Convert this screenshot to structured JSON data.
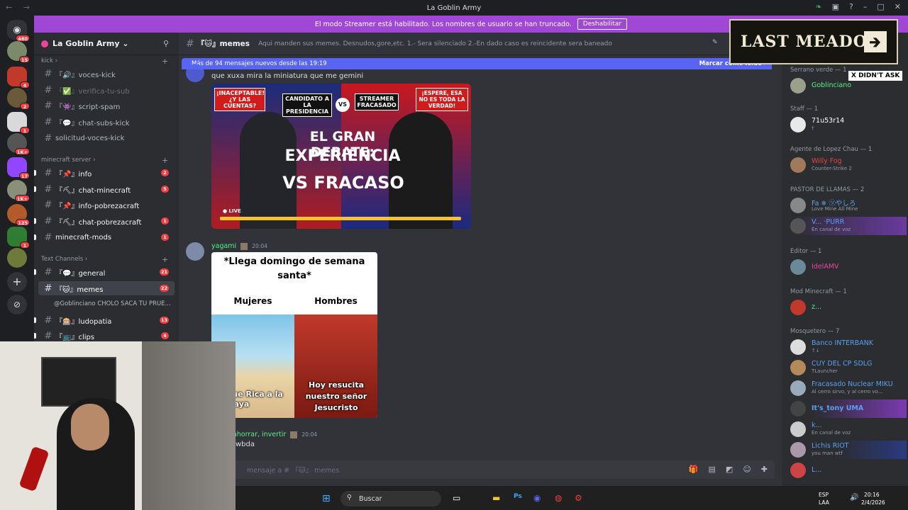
{
  "window": {
    "title": "La Goblin Army",
    "nav_arrows": "← →"
  },
  "banner": {
    "text": "El modo Streamer está habilitado. Los nombres de usuario se han truncado.",
    "button": "Deshabilitar"
  },
  "rail": {
    "badges": [
      "460",
      "15",
      "4",
      "2",
      "1",
      "1K+",
      "17",
      "1K+",
      "125",
      "1"
    ]
  },
  "server": {
    "name": "La Goblin Army ⌄"
  },
  "categories": {
    "kick": "kick ›",
    "minecraft": "minecraft server ›",
    "text": "Text Channels ›"
  },
  "channels": [
    {
      "label": "『🔊』voces-kick",
      "count": ""
    },
    {
      "label": "『✅』verifica-tu-sub",
      "count": ""
    },
    {
      "label": "『👾』script-spam",
      "count": ""
    },
    {
      "label": "『💬』chat-subs-kick",
      "count": ""
    },
    {
      "label": "solicitud-voces-kick",
      "count": ""
    },
    {
      "label": "『📌』info",
      "count": "2"
    },
    {
      "label": "『⛏』chat-minecraft",
      "count": "5"
    },
    {
      "label": "『📌』info-pobrezacraft",
      "count": ""
    },
    {
      "label": "『⛏』chat-pobrezacraft",
      "count": "1"
    },
    {
      "label": "minecraft-mods",
      "count": "1"
    },
    {
      "label": "『💬』general",
      "count": "21"
    },
    {
      "label": "『🐱』memes",
      "count": "22"
    },
    {
      "label": "@Goblinciano CHOLO SACA TU PRUE...",
      "count": ""
    },
    {
      "label": "『🎰』ludopatia",
      "count": "13"
    },
    {
      "label": "『📺』clips",
      "count": "4"
    }
  ],
  "channel_header": {
    "name": "『🐱』memes",
    "topic": "Aqui manden sus memes. Desnudos,gore,etc. 1.- Sera silenciado 2.-En dado caso es reincidente sera baneado"
  },
  "new_messages": {
    "text": "Más de 94 mensajes nuevos desde las 19:19",
    "action": "Marcar como leído"
  },
  "messages": [
    {
      "text": "que xuxa mira la miniatura que me gemini"
    },
    {
      "author": "yagami",
      "time": "20:04"
    },
    {
      "author": "r, ahorrar, invertir",
      "time": "20:04",
      "text": "wbda"
    }
  ],
  "thumbnail": {
    "tag1": "¡INACEPTABLE! ¿Y LAS CUENTAS?",
    "tag2": "CANDIDATO A LA PRESIDENCIA",
    "vs_small": "VS",
    "tag3": "STREAMER FRACASADO",
    "tag4": "¡ESPERE, ESA NO ES TODA LA VERDAD!",
    "line1": "EL GRAN DEBATE:",
    "line2": "EXPERIENCIA",
    "line3": "VS FRACASO",
    "live": "● LIVE"
  },
  "meme": {
    "title": "*Llega domingo de semana santa*",
    "left": "Mujeres",
    "right": "Hombres",
    "left_caption": "Que Rica a la playa",
    "right_caption": "Hoy resucita nuestro señor Jesucristo"
  },
  "composer": {
    "placeholder": "mensaje a # 『🐱』 memes"
  },
  "overlay": {
    "title": "LAST MEADOW",
    "arrow": "🡲",
    "caption": "X DIDN'T ASK"
  },
  "members": {
    "groups": [
      {
        "name": "Serrano verde — 1",
        "users": [
          {
            "name": "Goblinciano",
            "status": "",
            "color": "#57f287"
          }
        ]
      },
      {
        "name": "Staff — 1",
        "users": [
          {
            "name": "71u53r14",
            "status": "†",
            "color": "#ffffff"
          }
        ]
      },
      {
        "name": "Agente de Lopez Chau — 1",
        "users": [
          {
            "name": "Willy Fog",
            "status": "Counter-Strike 2",
            "color": "#ed4245"
          }
        ]
      },
      {
        "name": "PASTOR DE LLAMAS — 2",
        "users": [
          {
            "name": "Fa ❄ ㋡やしろ",
            "status": "Love Mine All Mine",
            "color": "#5865f2"
          },
          {
            "name": "V... ·PURR",
            "status": "En canal de voz",
            "color": "#5865f2"
          }
        ]
      },
      {
        "name": "Editor — 1",
        "users": [
          {
            "name": "IdelAMV",
            "status": "",
            "color": "#eb459e"
          }
        ]
      },
      {
        "name": "Mod Minecraft — 1",
        "users": [
          {
            "name": "z...",
            "status": "",
            "color": "#57f287"
          }
        ]
      },
      {
        "name": "Mosquetero — 7",
        "users": [
          {
            "name": "Banco INTERBANK",
            "status": "↑↓",
            "color": "#5aa0f2"
          },
          {
            "name": "CUY DEL CP  SDLG",
            "status": "TLauncher",
            "color": "#5aa0f2"
          },
          {
            "name": "Fracasado Nuclear  MIKU",
            "status": "Al cerro sirvo, y al cerro vo...",
            "color": "#5aa0f2"
          },
          {
            "name": "It's_tony  UMA",
            "status": "",
            "color": "#5aa0f2"
          },
          {
            "name": "k...",
            "status": "En canal de voz",
            "color": "#5aa0f2"
          },
          {
            "name": "Lichis  RIOT",
            "status": "you man wtf",
            "color": "#5aa0f2"
          },
          {
            "name": "L...",
            "status": "",
            "color": "#5aa0f2"
          }
        ]
      }
    ]
  },
  "taskbar": {
    "search": "Buscar",
    "lang1": "ESP",
    "lang2": "LAA",
    "time": "20:16",
    "date": "2/4/2026"
  }
}
